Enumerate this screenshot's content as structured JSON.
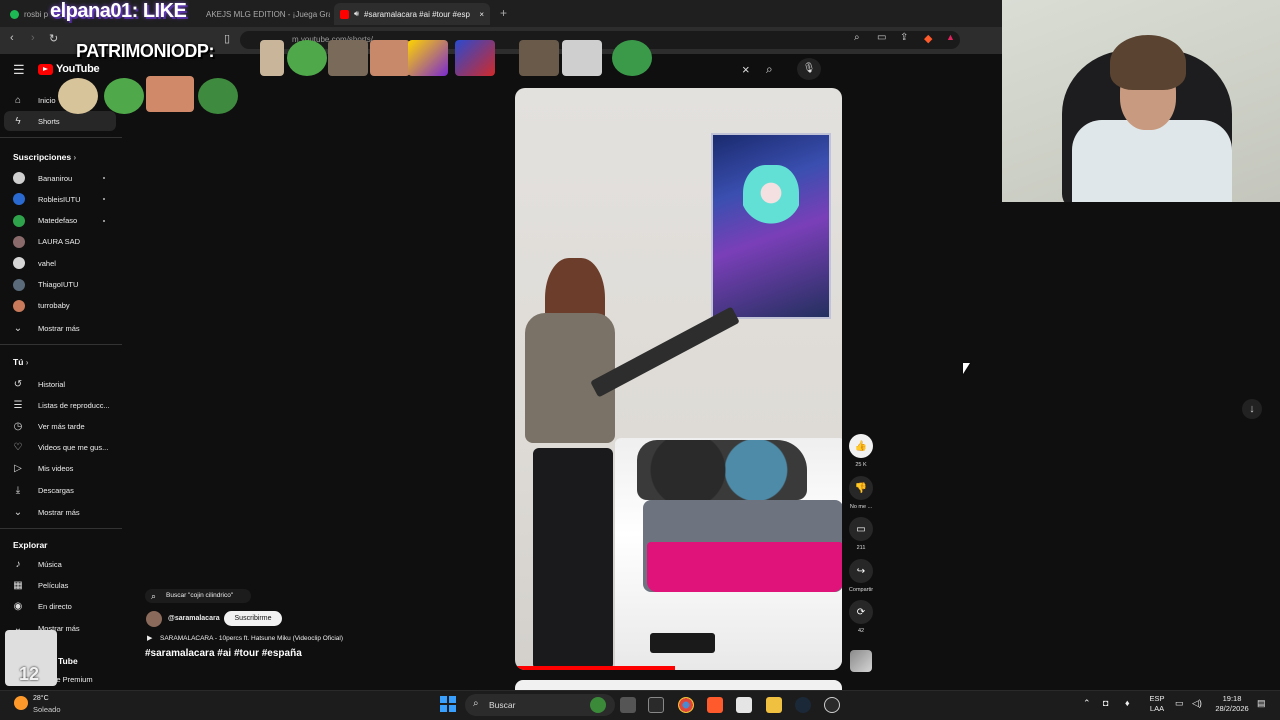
{
  "browser": {
    "tabs": [
      {
        "label": "rosbi p",
        "color": "#1db954"
      },
      {
        "label": "AKEJS MLG EDITION - ¡Juega Gra",
        "color": "#888888"
      },
      {
        "label": "#saramalacara #ai #tour #esp",
        "color": "#ff0000"
      }
    ],
    "url": "m.youtube.com/shorts/...",
    "new_tab": "+",
    "close_tab": "×"
  },
  "youtube": {
    "logo": "YouTube",
    "search_value": "cojin cilindrico",
    "search_clear": "×"
  },
  "sidebar": {
    "top": [
      {
        "label": "Inicio",
        "icon": "home-icon",
        "glyph": "⌂"
      },
      {
        "label": "Shorts",
        "icon": "shorts-icon",
        "glyph": "ϟ",
        "active": true
      }
    ],
    "subs_header": "Suscripciones",
    "subs": [
      {
        "label": "Bananirou",
        "color": "#cfcfcf",
        "dot": true
      },
      {
        "label": "RobleisIUTU",
        "color": "#2a6ad0",
        "dot": true
      },
      {
        "label": "Matedefaso",
        "color": "#2fa34b",
        "dot": true
      },
      {
        "label": "LAURA SAD",
        "color": "#8a6a6a",
        "dot": false
      },
      {
        "label": "vahel",
        "color": "#d6d6d6",
        "dot": false
      },
      {
        "label": "ThiagoIUTU",
        "color": "#5a6a7a",
        "dot": false
      },
      {
        "label": "turrobaby",
        "color": "#c87a5a",
        "dot": false
      }
    ],
    "more_subs": "Mostrar más",
    "you_header": "Tú",
    "you": [
      {
        "label": "Historial",
        "glyph": "↺"
      },
      {
        "label": "Listas de reproducc...",
        "glyph": "☰"
      },
      {
        "label": "Ver más tarde",
        "glyph": "◷"
      },
      {
        "label": "Videos que me gus...",
        "glyph": "♡"
      },
      {
        "label": "Mis videos",
        "glyph": "▷"
      },
      {
        "label": "Descargas",
        "glyph": "⤓"
      }
    ],
    "more_you": "Mostrar más",
    "explore_header": "Explorar",
    "explore": [
      {
        "label": "Música",
        "glyph": "♪"
      },
      {
        "label": "Películas",
        "glyph": "▦"
      },
      {
        "label": "En directo",
        "glyph": "◉"
      }
    ],
    "more_explore": "Mostrar más",
    "more_from": "Tube",
    "premium": "ube Premium"
  },
  "short": {
    "search_chip": "Buscar \"cojin cilindrico\"",
    "channel": "@saramalacara",
    "subscribe": "Suscribirme",
    "music": "SARAMALACARA - 10percs ft. Hatsune Miku (Videoclip Oficial)",
    "title": "#saramalacara #ai #tour #españa",
    "progress": 0.49
  },
  "actions": [
    {
      "name": "like",
      "glyph": "👍",
      "label": "25 K"
    },
    {
      "name": "dislike",
      "glyph": "👎",
      "label": "No me ..."
    },
    {
      "name": "comments",
      "glyph": "▭",
      "label": "211"
    },
    {
      "name": "share",
      "glyph": "↪",
      "label": "Compartir"
    },
    {
      "name": "remix",
      "glyph": "⟳",
      "label": "42"
    }
  ],
  "overlay": {
    "elpana": "elpana01: LIKE",
    "patrimonio": "PATRIMONIODP:",
    "corner_number": "12"
  },
  "taskbar": {
    "weather_temp": "28°C",
    "weather_desc": "Soleado",
    "search": "Buscar",
    "lang1": "ESP",
    "lang2": "LAA",
    "time": "19:18",
    "date": "28/2/2026"
  }
}
